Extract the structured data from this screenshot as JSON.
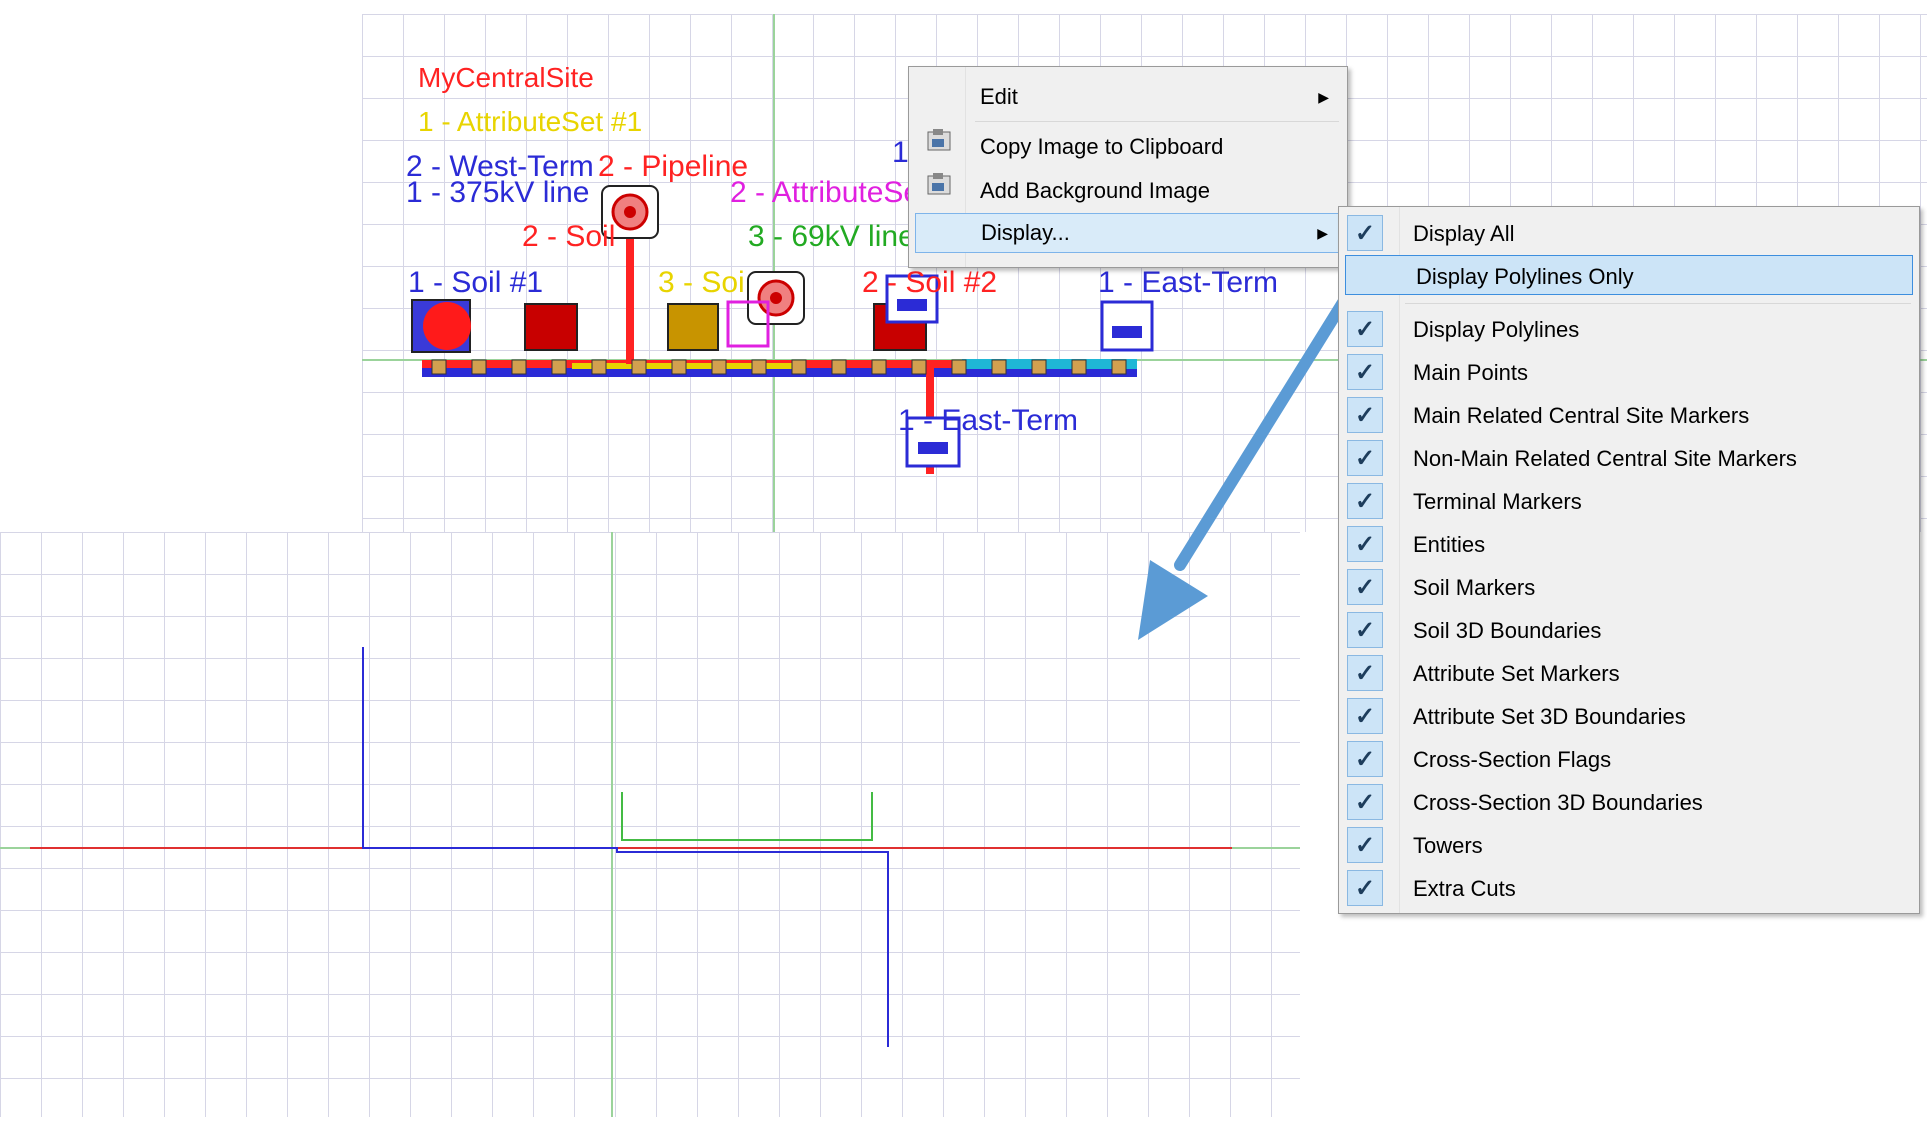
{
  "top_view": {
    "labels": {
      "site": "MyCentralSite",
      "attrset1": "1 - AttributeSet #1",
      "westterm": "2 - West-Term",
      "pipeline": "2 - Pipeline",
      "line375": "1 - 375kV line",
      "attrset2": "2 - AttributeSe",
      "soil2a": "2 - Soil",
      "kv69": "3 - 69kV line",
      "soil1": "1 - Soil #1",
      "soil3": "3 - Soi",
      "soil2b": "2 - Soil #2",
      "eastterm1": "1 - East-Term",
      "eastterm2": "1 - East-Term",
      "one": "1"
    },
    "colors": {
      "red": "#ff2222",
      "blue": "#2b2bd6",
      "yellow": "#e8d400",
      "magenta": "#e020e0",
      "green": "#22aa22",
      "cyan": "#1fb7d6"
    }
  },
  "context_menu": {
    "items": [
      {
        "label": "Edit",
        "submenu": true,
        "icon": ""
      },
      {
        "label": "Copy Image to Clipboard",
        "submenu": false,
        "icon": "clipboard-icon"
      },
      {
        "label": "Add Background Image",
        "submenu": false,
        "icon": "image-icon"
      },
      {
        "label": "Display...",
        "submenu": true,
        "icon": "",
        "highlighted": true
      }
    ],
    "arrow_glyph": "▶"
  },
  "display_submenu": {
    "check_glyph": "✓",
    "items": [
      {
        "label": "Display All",
        "checked": true
      },
      {
        "label": "Display Polylines Only",
        "checked": false,
        "highlighted": true
      },
      {
        "label": "Display Polylines",
        "checked": true
      },
      {
        "label": "Main Points",
        "checked": true
      },
      {
        "label": "Main Related Central Site Markers",
        "checked": true
      },
      {
        "label": "Non-Main Related Central Site Markers",
        "checked": true
      },
      {
        "label": "Terminal Markers",
        "checked": true
      },
      {
        "label": "Entities",
        "checked": true
      },
      {
        "label": "Soil Markers",
        "checked": true
      },
      {
        "label": "Soil 3D Boundaries",
        "checked": true
      },
      {
        "label": "Attribute Set Markers",
        "checked": true
      },
      {
        "label": "Attribute Set 3D Boundaries",
        "checked": true
      },
      {
        "label": "Cross-Section Flags",
        "checked": true
      },
      {
        "label": "Cross-Section 3D Boundaries",
        "checked": true
      },
      {
        "label": "Towers",
        "checked": true
      },
      {
        "label": "Extra Cuts",
        "checked": true
      }
    ]
  },
  "arrow": {
    "color": "#5b9bd5",
    "meaning": "Display Polylines Only result"
  }
}
